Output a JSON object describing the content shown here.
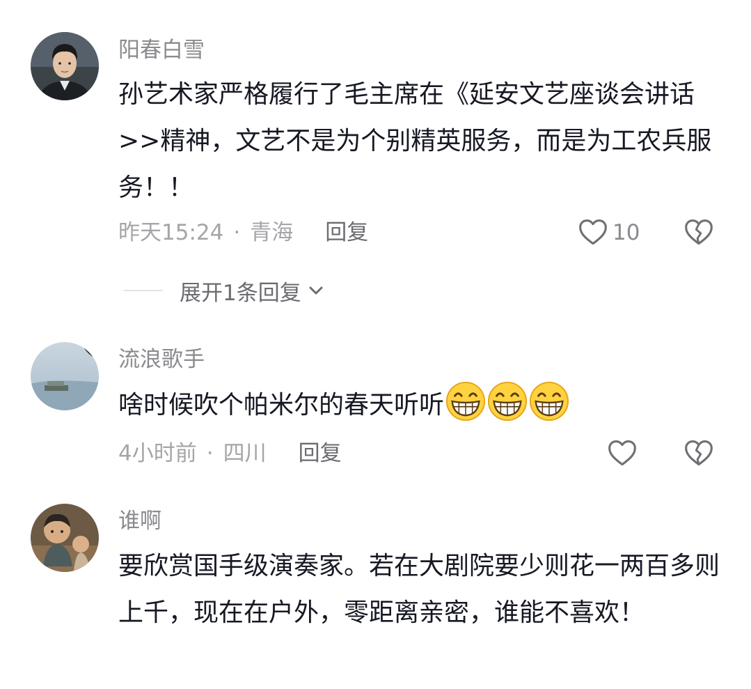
{
  "comments": [
    {
      "username": "阳春白雪",
      "avatar_icon": "man-portrait-avatar",
      "text": "孙艺术家严格履行了毛主席在《延安文艺座谈会讲话>>精神，文艺不是为个别精英服务，而是为工农兵服务！！",
      "time": "昨天15:24",
      "location": "青海",
      "reply_label": "回复",
      "likes": "10",
      "expand_label": "展开1条回复"
    },
    {
      "username": "流浪歌手",
      "avatar_icon": "lake-landscape-avatar",
      "text": "啥时候吹个帕米尔的春天听听",
      "emojis": [
        "grinning-face-icon",
        "grinning-face-icon",
        "grinning-face-icon"
      ],
      "time": "4小时前",
      "location": "四川",
      "reply_label": "回复",
      "likes": ""
    },
    {
      "username": "谁啊",
      "avatar_icon": "clay-figurines-avatar",
      "text": "要欣赏国手级演奏家。若在大剧院要少则花一两百多则上千，现在在户外，零距离亲密，谁能不喜欢！"
    }
  ],
  "separator": "·",
  "colors": {
    "text": "#161823",
    "secondary": "#8a8a8f",
    "meta": "#a5a5a9",
    "emoji_face": "#ffd23f"
  }
}
